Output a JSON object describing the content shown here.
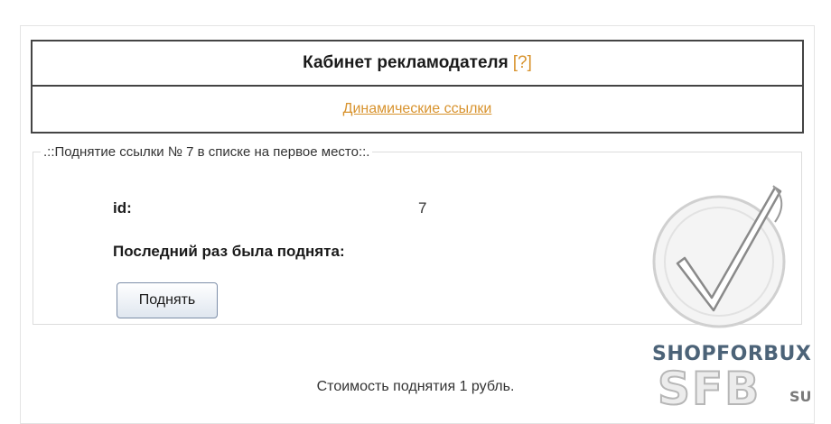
{
  "header": {
    "title": "Кабинет рекламодателя",
    "help_link": "[?]",
    "nav_link": "Динамические ссылки"
  },
  "lift_box": {
    "legend": ".::Поднятие ссылки № 7 в списке на первое место::.",
    "id_label": "id:",
    "id_value": "7",
    "last_lifted_label": "Последний раз была поднята:",
    "lift_button_label": "Поднять"
  },
  "cost_text": "Стоимость поднятия 1 рубль.",
  "watermark": {
    "icon": "checkmark-seal-icon",
    "brand": "SHOPFORBUX",
    "big": "SFB",
    "tld": "SU"
  },
  "colors": {
    "link": "#d8932e",
    "border": "#444444",
    "button_border": "#7d8ea8"
  }
}
